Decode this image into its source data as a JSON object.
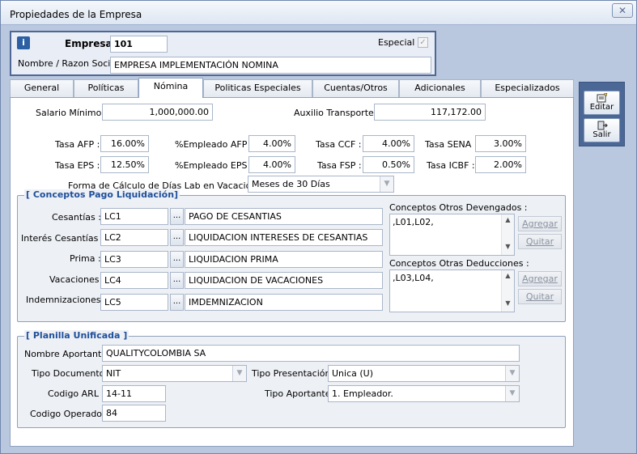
{
  "window": {
    "title": "Propiedades de la Empresa",
    "close_glyph": "✕"
  },
  "header": {
    "info_glyph": "i",
    "empresa_label": "Empresa",
    "empresa_value": "101",
    "especial_label": "Especial",
    "especial_checked": true,
    "razon_label": "Nombre / Razon Social",
    "razon_value": "EMPRESA IMPLEMENTACIÓN NOMINA"
  },
  "tabs": [
    "General",
    "Políticas",
    "Nómina",
    "Politicas Especiales",
    "Cuentas/Otros",
    "Adicionales",
    "Especializados"
  ],
  "active_tab": "Nómina",
  "nomina": {
    "salario_minimo_label": "Salario Mínimo :",
    "salario_minimo": "1,000,000.00",
    "auxilio_label": "Auxilio Transporte :",
    "auxilio": "117,172.00",
    "tasa_afp_label": "Tasa AFP :",
    "tasa_afp": "16.00%",
    "emp_afp_label": "%Empleado AFP :",
    "emp_afp": "4.00%",
    "tasa_ccf_label": "Tasa CCF :",
    "tasa_ccf": "4.00%",
    "tasa_sena_label": "Tasa SENA :",
    "tasa_sena": "3.00%",
    "tasa_eps_label": "Tasa EPS :",
    "tasa_eps": "12.50%",
    "emp_eps_label": "%Empleado EPS :",
    "emp_eps": "4.00%",
    "tasa_fsp_label": "Tasa FSP :",
    "tasa_fsp": "0.50%",
    "tasa_icbf_label": "Tasa ICBF :",
    "tasa_icbf": "2.00%",
    "forma_label": "Forma de Cálculo de Días Lab en Vacaciones :",
    "forma_value": "Meses de 30 Días"
  },
  "liquidacion": {
    "title": "[ Conceptos Pago Liquidación]",
    "rows": [
      {
        "label": "Cesantías :",
        "code": "LC1",
        "desc": "PAGO DE CESANTIAS"
      },
      {
        "label": "Interés Cesantías :",
        "code": "LC2",
        "desc": "LIQUIDACION INTERESES DE CESANTIAS"
      },
      {
        "label": "Prima :",
        "code": "LC3",
        "desc": "LIQUIDACION PRIMA"
      },
      {
        "label": "Vacaciones :",
        "code": "LC4",
        "desc": "LIQUIDACION DE VACACIONES"
      },
      {
        "label": "Indemnizaciones :",
        "code": "LC5",
        "desc": "IMDEMNIZACION"
      }
    ],
    "dots": "...",
    "devengados_label": "Conceptos Otros Devengados :",
    "devengados_value": ",L01,L02,",
    "deducciones_label": "Conceptos Otras Deducciones :",
    "deducciones_value": ",L03,L04,",
    "agregar": "Agregar",
    "quitar": "Quitar"
  },
  "planilla": {
    "title": "[ Planilla Unificada ]",
    "nombre_label": "Nombre Aportante :",
    "nombre_value": "QUALITYCOLOMBIA SA",
    "tipo_doc_label": "Tipo Documento :",
    "tipo_doc_value": "NIT",
    "tipo_pres_label": "Tipo Presentación :",
    "tipo_pres_value": "Unica (U)",
    "arl_label": "Codigo ARL :",
    "arl_value": "14-11",
    "tipo_aport_label": "Tipo Aportante :",
    "tipo_aport_value": "1. Empleador.",
    "operador_label": "Codigo Operador :",
    "operador_value": "84"
  },
  "side": {
    "editar": "Editar",
    "salir": "Salir"
  }
}
